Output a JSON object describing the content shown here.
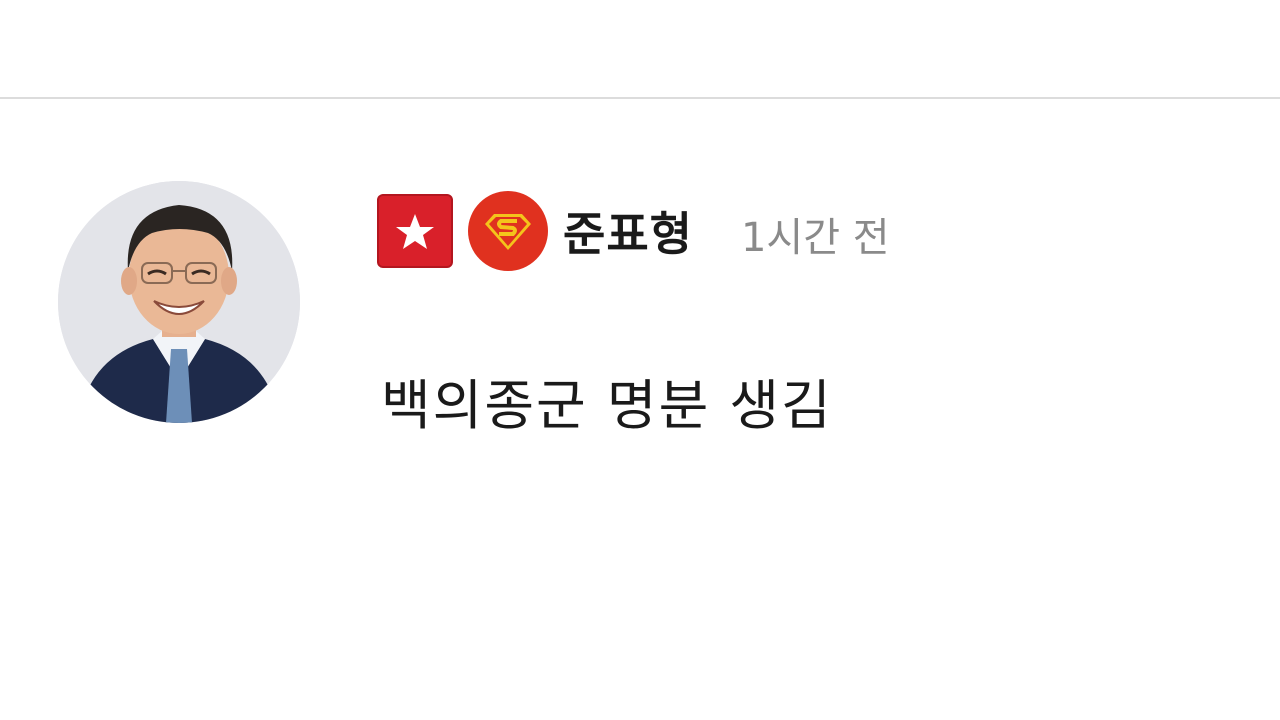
{
  "post": {
    "author": {
      "name": "준표형",
      "badges": [
        "star-badge-icon",
        "superman-badge-icon"
      ],
      "avatar": "profile-photo"
    },
    "timestamp": "1시간 전",
    "content": "백의종군 명분 생김"
  },
  "colors": {
    "badge_red": "#d9202a",
    "superman_red": "#e0311f",
    "superman_yellow": "#f4c41b",
    "divider": "#dcdcdc",
    "text_primary": "#1a1a1a",
    "text_muted": "#8a8a8a"
  }
}
